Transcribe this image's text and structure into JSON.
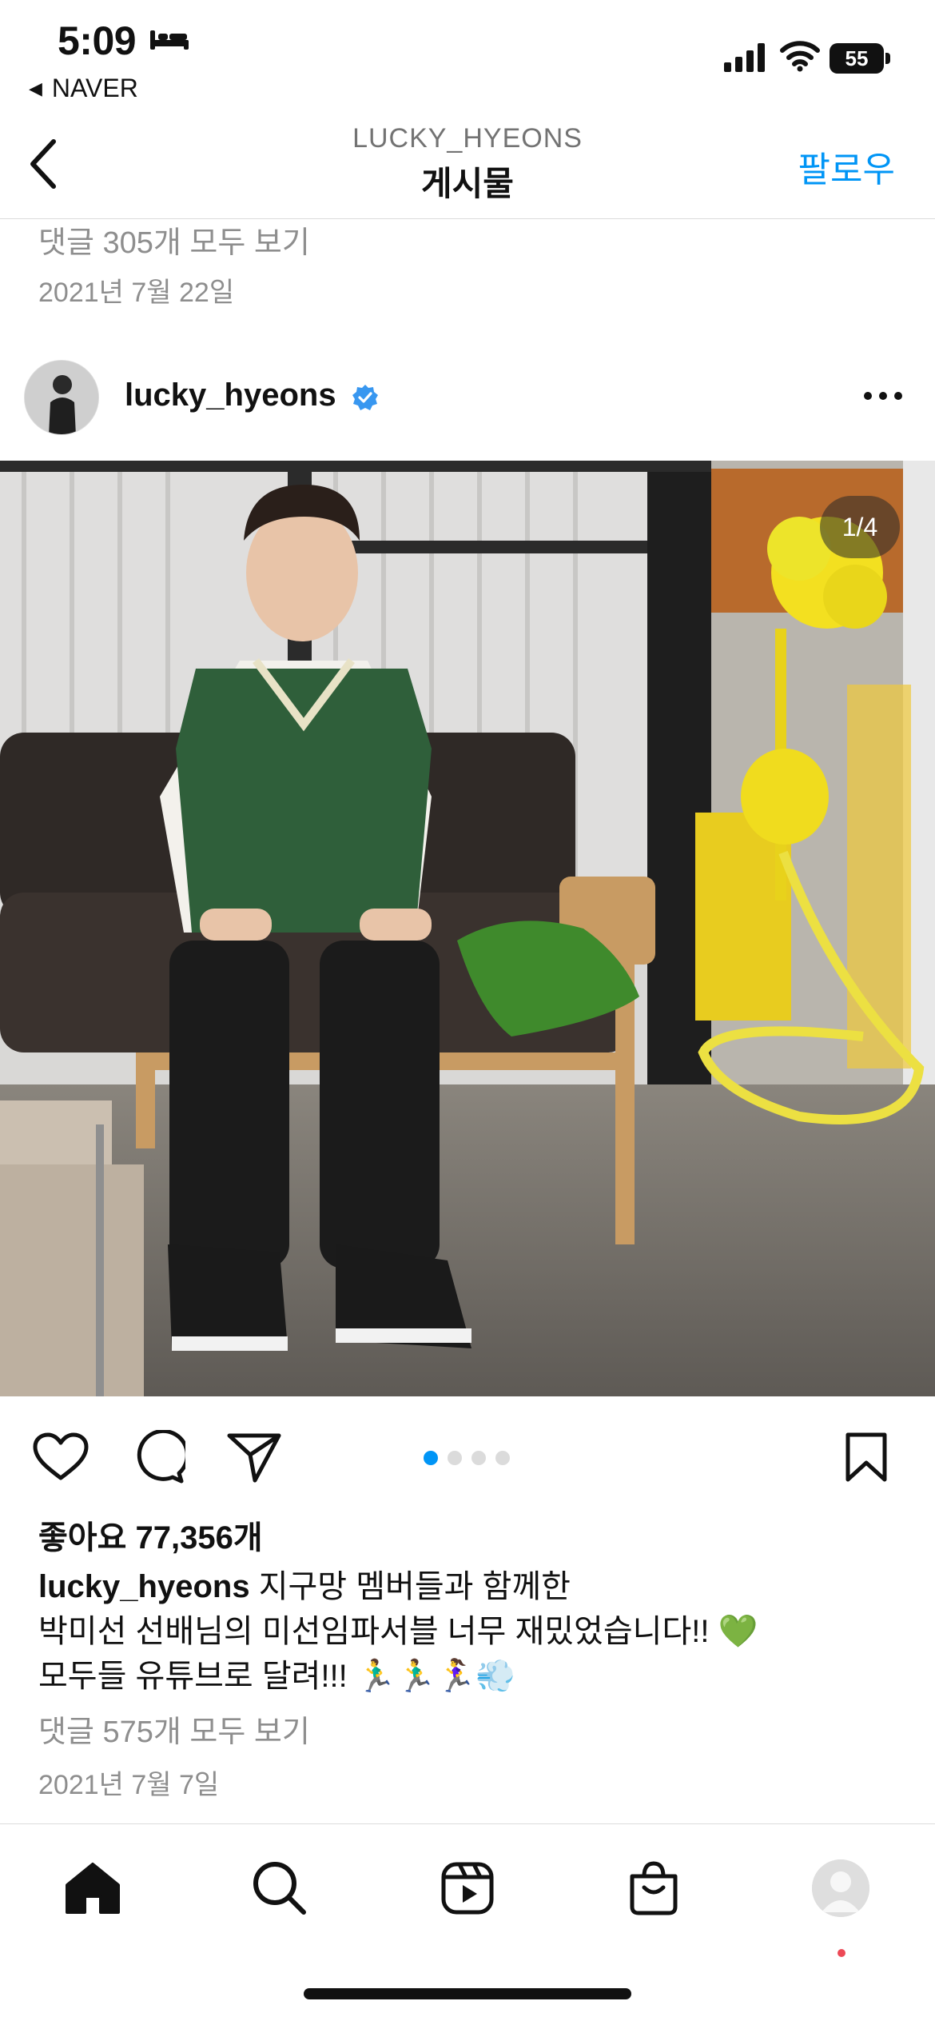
{
  "status_bar": {
    "time": "5:09",
    "back_app": "NAVER",
    "battery": "55",
    "icons": [
      "bed-icon",
      "signal-icon",
      "wifi-icon",
      "battery-icon"
    ]
  },
  "header": {
    "username": "LUCKY_HYEONS",
    "title": "게시물",
    "follow_label": "팔로우",
    "back_icon": "chevron-left-icon"
  },
  "previous_post": {
    "comments_link": "댓글 305개 모두 보기",
    "date": "2021년 7월 22일"
  },
  "post": {
    "username": "lucky_hyeons",
    "verified": true,
    "page_counter": "1/4",
    "carousel_total": 4,
    "carousel_active": 1,
    "likes": "좋아요 77,356개",
    "caption_username": "lucky_hyeons",
    "caption_line1": "지구망 멤버들과 함께한",
    "caption_line2": "박미선 선배님의 미선임파서블 너무 재밌었습니다!! 💚",
    "caption_line3": "모두들 유튜브로 달려!!! 🏃‍♂️🏃‍♂️🏃‍♀️💨",
    "comments_link": "댓글 575개 모두 보기",
    "date": "2021년 7월 7일"
  },
  "actions": [
    "heart-icon",
    "comment-icon",
    "share-icon",
    "bookmark-icon"
  ],
  "bottom_nav": [
    "home-icon",
    "search-icon",
    "reels-icon",
    "shop-icon",
    "profile-avatar"
  ],
  "colors": {
    "accent": "#0095f6",
    "secondary_text": "#8e8e8e",
    "verified": "#3897f0",
    "notification": "#ed4956"
  }
}
